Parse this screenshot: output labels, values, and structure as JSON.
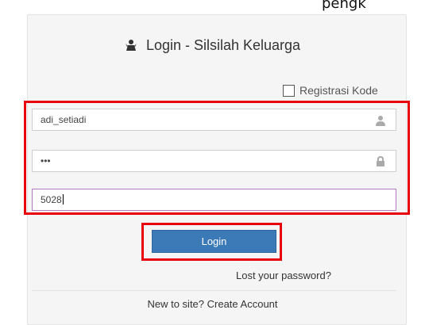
{
  "header_partial": "pengk",
  "login": {
    "title": "Login - Silsilah Keluarga",
    "title_icon": "user-icon",
    "registration_label": "Registrasi Kode",
    "username_value": "adi_setiadi",
    "password_mask": "•••",
    "code_value": "5028",
    "button_label": "Login",
    "lost_password": "Lost your password?",
    "signup_text": "New to site? Create Account"
  },
  "colors": {
    "accent": "#3b79b7",
    "highlight": "#e8000b"
  }
}
